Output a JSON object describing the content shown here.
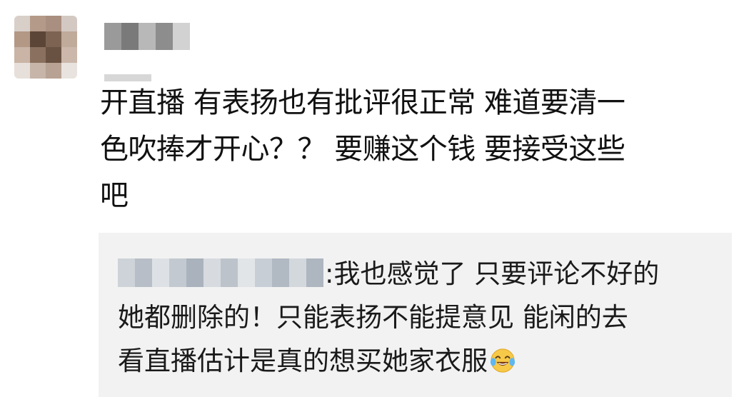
{
  "comment": {
    "line1": "开直播 有表扬也有批评很正常 难道要清一",
    "line2": "色吹捧才开心？？ 要赚这个钱 要接受这些",
    "line3": "吧"
  },
  "reply": {
    "separator": ":",
    "line1_text": "我也感觉了 只要评论不好的",
    "line2_text": "她都删除的！只能表扬不能提意见 能闲的去",
    "line3_text": "看直播估计是真的想买她家衣服",
    "emoji": "laughing-tears-emoji"
  },
  "colors": {
    "reply_background": "#f2f2f2",
    "text": "#111111"
  }
}
